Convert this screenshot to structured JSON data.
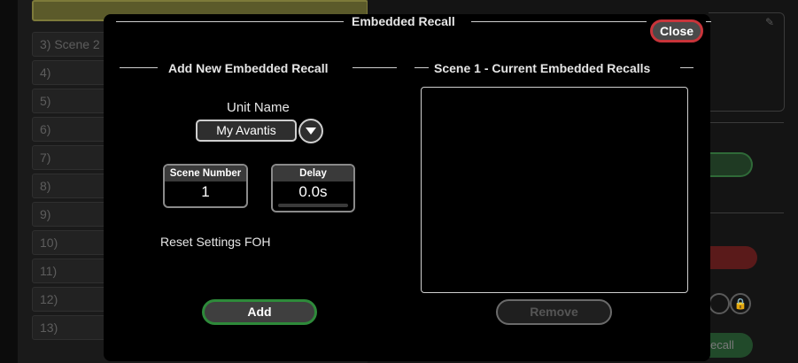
{
  "background": {
    "top_item": "",
    "rows": [
      "3) Scene 2",
      "4)",
      "5)",
      "6)",
      "7)",
      "8)",
      "9)",
      "10)",
      "11)",
      "12)",
      "13)"
    ],
    "recall_partial": "ecall"
  },
  "modal": {
    "title": "Embedded Recall",
    "close_label": "Close",
    "add_section": {
      "title": "Add New Embedded Recall",
      "unit_name_label": "Unit Name",
      "unit_name_value": "My Avantis",
      "scene_number_label": "Scene Number",
      "scene_number_value": "1",
      "delay_label": "Delay",
      "delay_value": "0.0s",
      "reset_settings_text": "Reset Settings FOH",
      "add_label": "Add"
    },
    "current_section": {
      "title": "Scene 1 - Current Embedded Recalls",
      "items": [],
      "remove_label": "Remove"
    }
  },
  "colors": {
    "close_border": "#c8343a",
    "add_border": "#2e8a3a",
    "modal_bg": "#000000"
  }
}
